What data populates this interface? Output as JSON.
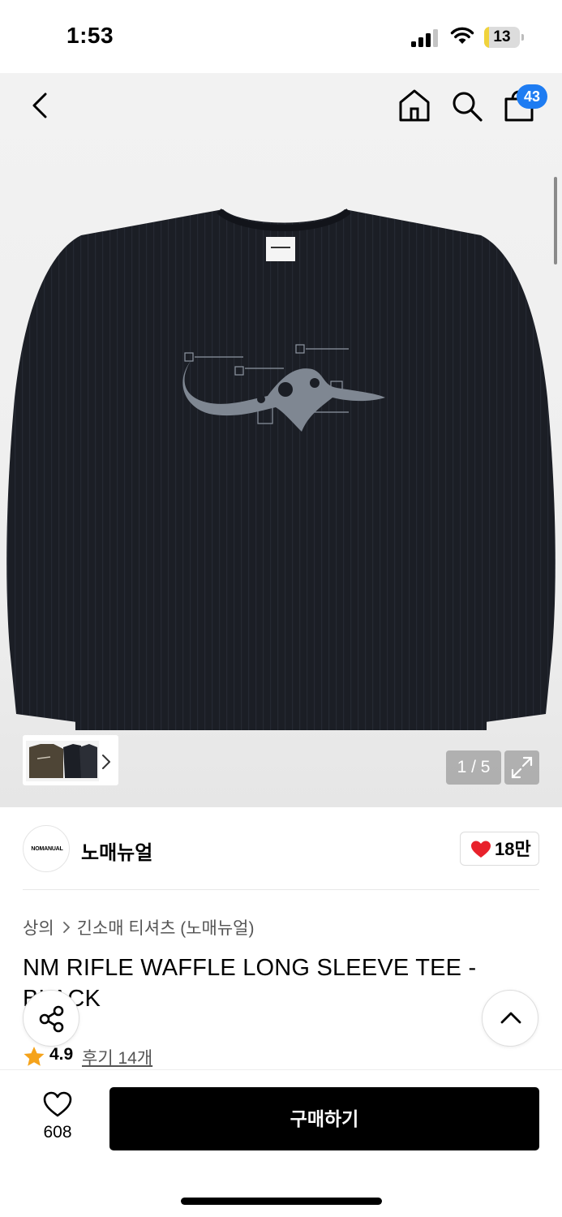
{
  "status_bar": {
    "time": "1:53",
    "battery_level": "13"
  },
  "header": {
    "cart_count": "43"
  },
  "gallery": {
    "page_counter": "1 / 5",
    "current_page": 1,
    "total_pages": 5
  },
  "brand": {
    "logo_text": "NOMANUAL",
    "name": "노매뉴얼",
    "like_count": "18만"
  },
  "breadcrumb": {
    "category": "상의",
    "subcategory": "긴소매 티셔츠 (노매뉴얼)"
  },
  "product": {
    "title": "NM RIFLE WAFFLE LONG SLEEVE TEE - BLACK",
    "rating": "4.9",
    "review_link": "후기 14개"
  },
  "bottom_bar": {
    "wish_count": "608",
    "buy_label": "구매하기"
  },
  "colors": {
    "badge": "#1e7cf2",
    "like_heart": "#e8212b",
    "rating_star": "#f5a31b",
    "buy_button": "#000000"
  },
  "icons": [
    "back-icon",
    "home-icon",
    "search-icon",
    "cart-icon",
    "chevron-right-icon",
    "expand-icon",
    "heart-icon",
    "share-icon",
    "chevron-up-icon",
    "star-icon"
  ]
}
